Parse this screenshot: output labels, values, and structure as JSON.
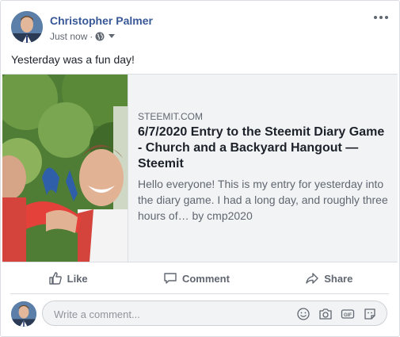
{
  "post": {
    "author": "Christopher Palmer",
    "timestamp": "Just now",
    "separator": "·",
    "text": "Yesterday was a fun day!"
  },
  "link_preview": {
    "domain": "STEEMIT.COM",
    "title": "6/7/2020 Entry to the Steemit Diary Game - Church and a Backyard Hangout — Steemit",
    "description": "Hello everyone! This is my entry for yesterday into the diary game. I had a long day, and roughly three hours of… by cmp2020"
  },
  "actions": {
    "like": "Like",
    "comment": "Comment",
    "share": "Share"
  },
  "comment_input": {
    "placeholder": "Write a comment...",
    "value": ""
  },
  "icons": {
    "audience": "globe-icon",
    "audience_menu": "chevron-down-icon",
    "more": "more-options-icon",
    "like": "thumbs-up-icon",
    "comment": "speech-bubble-icon",
    "share": "share-arrow-icon",
    "emoji": "emoji-icon",
    "camera": "camera-icon",
    "gif": "gif-icon",
    "sticker": "sticker-icon"
  },
  "colors": {
    "author_link": "#385898",
    "secondary_text": "#606770",
    "preview_bg": "#f2f3f5",
    "border": "#dadde1"
  }
}
